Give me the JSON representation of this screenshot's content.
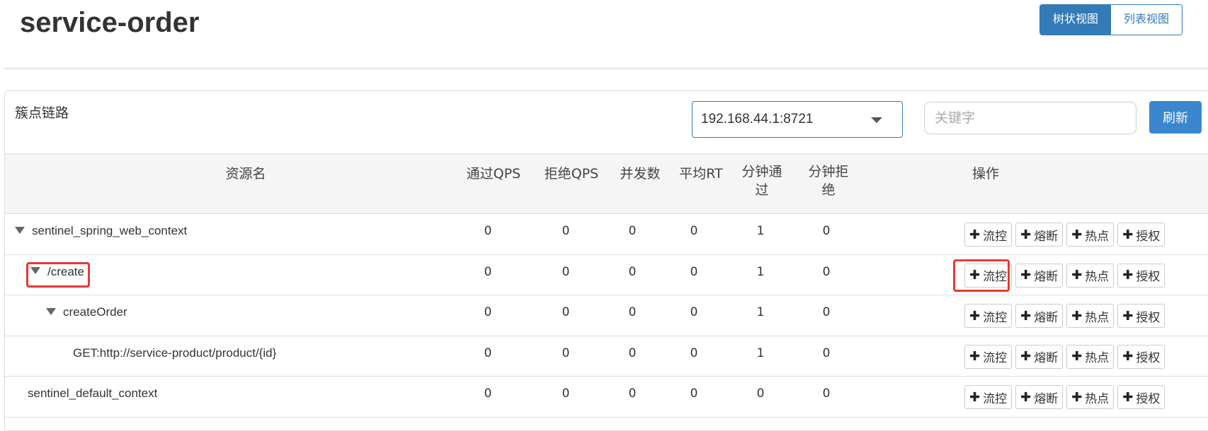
{
  "app": {
    "title": "service-order"
  },
  "view_toggle": {
    "tree": "树状视图",
    "list": "列表视图"
  },
  "panel": {
    "title": "簇点链路",
    "machine_select": "192.168.44.1:8721",
    "keyword_placeholder": "关键字",
    "refresh": "刷新"
  },
  "table": {
    "headers": {
      "resource": "资源名",
      "pass_qps": "通过QPS",
      "block_qps": "拒绝QPS",
      "concurrency": "并发数",
      "avg_rt": "平均RT",
      "minute_pass_1": "分钟通",
      "minute_pass_2": "过",
      "minute_block_1": "分钟拒",
      "minute_block_2": "绝",
      "actions": "操作"
    },
    "action_labels": {
      "flow": "流控",
      "degrade": "熔断",
      "hotspot": "热点",
      "authority": "授权",
      "plus_icon": "plus-icon"
    },
    "rows": [
      {
        "name": "sentinel_spring_web_context",
        "pass_qps": "0",
        "block_qps": "0",
        "concurrency": "0",
        "avg_rt": "0",
        "minute_pass": "1",
        "minute_block": "0"
      },
      {
        "name": "/create",
        "pass_qps": "0",
        "block_qps": "0",
        "concurrency": "0",
        "avg_rt": "0",
        "minute_pass": "1",
        "minute_block": "0"
      },
      {
        "name": "createOrder",
        "pass_qps": "0",
        "block_qps": "0",
        "concurrency": "0",
        "avg_rt": "0",
        "minute_pass": "1",
        "minute_block": "0"
      },
      {
        "name": "GET:http://service-product/product/{id}",
        "pass_qps": "0",
        "block_qps": "0",
        "concurrency": "0",
        "avg_rt": "0",
        "minute_pass": "1",
        "minute_block": "0"
      },
      {
        "name": "sentinel_default_context",
        "pass_qps": "0",
        "block_qps": "0",
        "concurrency": "0",
        "avg_rt": "0",
        "minute_pass": "0",
        "minute_block": "0"
      }
    ]
  },
  "colors": {
    "primary": "#337ab7",
    "highlight": "#e53935"
  }
}
